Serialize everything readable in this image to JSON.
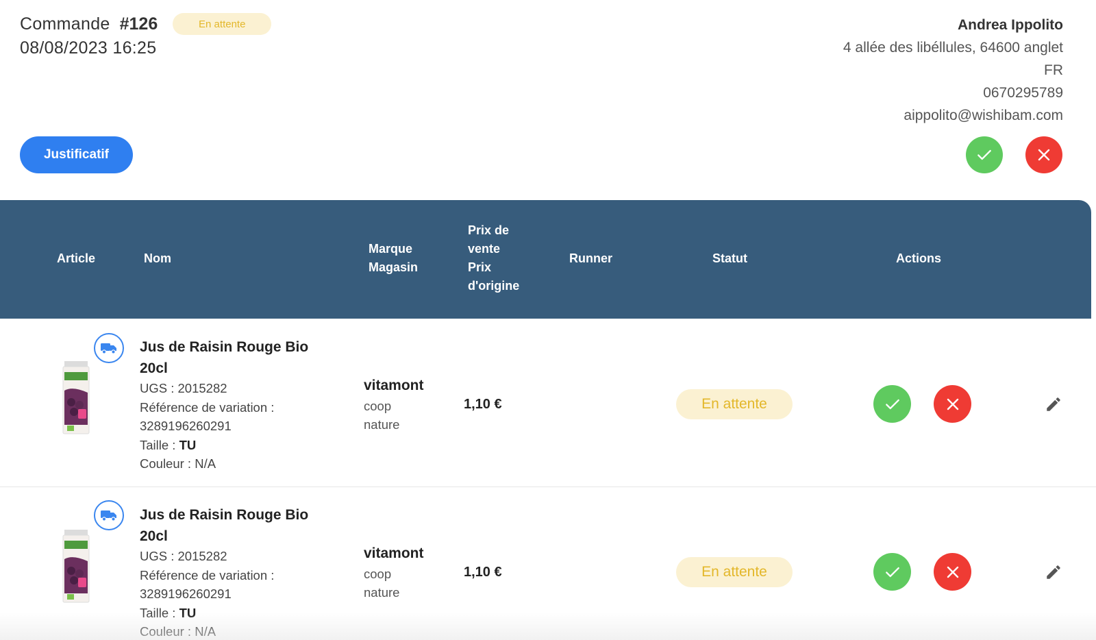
{
  "order": {
    "label": "Commande",
    "number": "#126",
    "status": "En attente",
    "date": "08/08/2023 16:25"
  },
  "customer": {
    "name": "Andrea Ippolito",
    "address": "4 allée des libéllules, 64600 anglet",
    "country": "FR",
    "phone": "0670295789",
    "email": "aippolito@wishibam.com"
  },
  "justificatif_label": "Justificatif",
  "table": {
    "headers": {
      "article": "Article",
      "nom": "Nom",
      "marque_line1": "Marque",
      "marque_line2": "Magasin",
      "prix_line1": "Prix de",
      "prix_line2": "vente",
      "prix_line3": "Prix",
      "prix_line4": "d'origine",
      "runner": "Runner",
      "statut": "Statut",
      "actions": "Actions"
    },
    "rows": [
      {
        "name": "Jus de Raisin Rouge Bio 20cl",
        "ugs": "UGS : 2015282",
        "ref_label": "Référence de variation :",
        "ref_value": "3289196260291",
        "taille_label": "Taille : ",
        "taille_value": "TU",
        "couleur": "Couleur : N/A",
        "brand": "vitamont",
        "store": "coop nature",
        "price": "1,10 €",
        "status": "En attente"
      },
      {
        "name": "Jus de Raisin Rouge Bio 20cl",
        "ugs": "UGS : 2015282",
        "ref_label": "Référence de variation :",
        "ref_value": "3289196260291",
        "taille_label": "Taille : ",
        "taille_value": "TU",
        "couleur": "Couleur : N/A",
        "brand": "vitamont",
        "store": "coop nature",
        "price": "1,10 €",
        "status": "En attente"
      }
    ]
  },
  "colors": {
    "primary": "#2f7ff0",
    "header_bg": "#375c7c",
    "accept": "#5fca5f",
    "reject": "#ef3b34",
    "pending_bg": "#fbf1d2",
    "pending_text": "#e3b72a"
  },
  "icons": {
    "accept": "check-icon",
    "reject": "close-icon",
    "delivery": "truck-icon",
    "edit": "pencil-icon"
  }
}
